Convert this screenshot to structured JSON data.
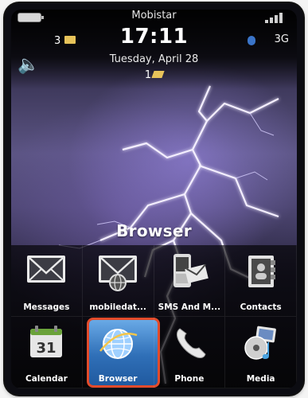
{
  "status": {
    "carrier": "Mobistar",
    "time": "17:11",
    "date": "Tuesday, April 28",
    "network": "3G",
    "message_count": "3",
    "unread_count": "1"
  },
  "focus_label": "Browser",
  "apps": [
    {
      "label": "Messages",
      "icon": "envelope-icon"
    },
    {
      "label": "mobiledat...",
      "icon": "mobile-data-mail-icon"
    },
    {
      "label": "SMS And M...",
      "icon": "sms-mms-icon"
    },
    {
      "label": "Contacts",
      "icon": "contacts-book-icon"
    },
    {
      "label": "Calendar",
      "icon": "calendar-icon",
      "day": "31"
    },
    {
      "label": "Browser",
      "icon": "globe-icon",
      "selected": true
    },
    {
      "label": "Phone",
      "icon": "phone-handset-icon"
    },
    {
      "label": "Media",
      "icon": "media-icon"
    }
  ],
  "colors": {
    "selection_border": "#e24b2b",
    "selection_fill": "#2f6fb7",
    "envelope_accent": "#e7c35a"
  }
}
